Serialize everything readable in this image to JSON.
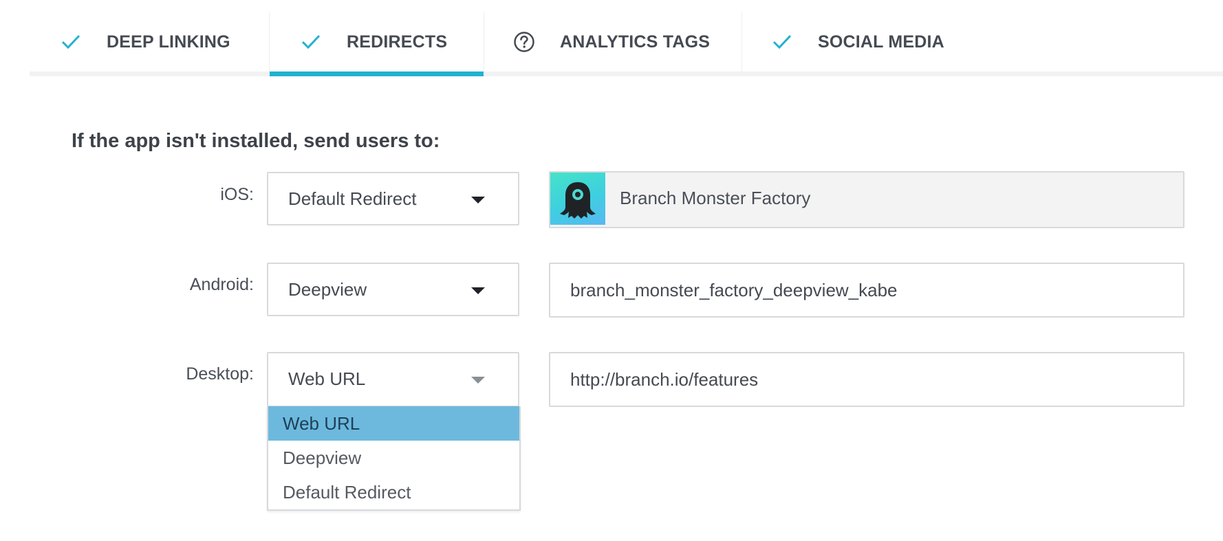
{
  "tabs": [
    {
      "label": "DEEP LINKING",
      "icon": "check-icon",
      "active": false
    },
    {
      "label": "REDIRECTS",
      "icon": "check-icon",
      "active": true
    },
    {
      "label": "ANALYTICS TAGS",
      "icon": "question-circle-icon",
      "active": false
    },
    {
      "label": "SOCIAL MEDIA",
      "icon": "check-icon",
      "active": false
    }
  ],
  "colors": {
    "accent": "#22b1d1",
    "check": "#22b1d1",
    "dropdown_selected": "#6db9de"
  },
  "section": {
    "title": "If the app isn't installed, send users to:"
  },
  "rows": {
    "ios": {
      "label": "iOS:",
      "selected": "Default Redirect",
      "value": "Branch Monster Factory",
      "icon": "branch-monster-app-icon"
    },
    "android": {
      "label": "Android:",
      "selected": "Deepview",
      "value": "branch_monster_factory_deepview_kabe"
    },
    "desktop": {
      "label": "Desktop:",
      "selected": "Web URL",
      "value": "http://branch.io/features"
    }
  },
  "dropdown": {
    "options": [
      "Web URL",
      "Deepview",
      "Default Redirect"
    ],
    "selected": "Web URL"
  }
}
